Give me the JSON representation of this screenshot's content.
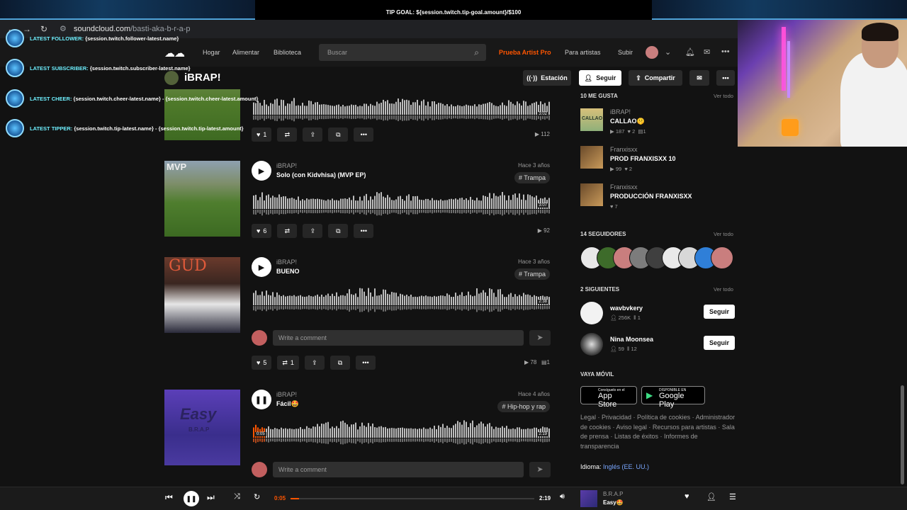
{
  "overlay": {
    "tip_goal": "TIP GOAL: ${session.twitch.tip-goal.amount}/$100",
    "alerts": [
      {
        "label": "LATEST FOLLOWER:",
        "value": "{session.twitch.follower-latest.name}"
      },
      {
        "label": "LATEST SUBSCRIBER:",
        "value": "{session.twitch.subscriber-latest.name}"
      },
      {
        "label": "LATEST CHEER:",
        "value": "{session.twitch.cheer-latest.name} - {session.twitch.cheer-latest.amount}"
      },
      {
        "label": "LATEST TIPPER:",
        "value": "{session.twitch.tip-latest.name} - {session.twitch.tip-latest.amount}"
      }
    ]
  },
  "browser": {
    "url_domain": "soundcloud.com",
    "url_path": "/basti-aka-b-r-a-p"
  },
  "header": {
    "logo": "SoundCloud",
    "nav": [
      "Hogar",
      "Alimentar",
      "Biblioteca"
    ],
    "search_placeholder": "Buscar",
    "artist_pro": "Prueba Artist Pro",
    "for_artists": "Para artistas",
    "upload": "Subir"
  },
  "profile": {
    "name": "iBRAP!",
    "station": "Estación",
    "follow": "Seguir",
    "share": "Compartir"
  },
  "tracks": [
    {
      "likes": "1",
      "plays": "112",
      "duration": "3:02"
    },
    {
      "artist": "iBRAP!",
      "title": "Solo (con Kidvhisa) (MVP EP)",
      "date": "Hace 3 años",
      "tag": "# Trampa",
      "duration": "3:07",
      "likes": "6",
      "plays": "92"
    },
    {
      "artist": "iBRAP!",
      "title": "BUENO",
      "date": "Hace 3 años",
      "tag": "# Trampa",
      "duration": "2:38",
      "likes": "5",
      "reposts": "1",
      "plays": "78",
      "comments": "1",
      "comment_placeholder": "Write a comment"
    },
    {
      "artist": "iBRAP!",
      "title": "Fácil🤩",
      "date": "Hace 4 años",
      "tag": "# Hip-hop y rap",
      "duration": "2:19",
      "elapsed": "0:05",
      "comment_placeholder": "Write a comment"
    }
  ],
  "sidebar": {
    "likes_title": "10 ME GUSTA",
    "view_all": "Ver todo",
    "likes": [
      {
        "artist": "iBRAP!",
        "title": "CALLAO🤫",
        "plays": "187",
        "likes": "2",
        "comments": "1",
        "art_text": "CALLAO"
      },
      {
        "artist": "Franxisxx",
        "title": "PROD FRANXISXX 10",
        "plays": "99",
        "likes": "2"
      },
      {
        "artist": "Franxisxx",
        "title": "PRODUCCIÓN FRANXISXX",
        "likes": "7"
      }
    ],
    "followers_title": "14 SEGUIDORES",
    "followers": [
      "#e8e8e8",
      "#3d6b2a",
      "#c97e7e",
      "#7c7c7c",
      "#3f3f3f",
      "#e9e9e9",
      "#d8d8d8",
      "#2f7fd8",
      "#c97e7e"
    ],
    "following_title": "2 SIGUIENTES",
    "following": [
      {
        "name": "wavbvkery",
        "followers": "256K",
        "tracks": "1",
        "follow": "Seguir"
      },
      {
        "name": "Nina Moonsea",
        "followers": "59",
        "tracks": "12",
        "follow": "Seguir"
      }
    ],
    "mobile_title": "VAYA MÓVIL",
    "app_store_small": "Consíguelo en el",
    "app_store_big": "App Store",
    "play_small": "DISPONIBLE EN",
    "play_big": "Google Play",
    "footer": "Legal · Privacidad · Política de cookies · Administrador de cookies · Aviso legal · Recursos para artistas · Sala de prensa · Listas de éxitos · Informes de transparencia",
    "language_label": "Idioma:",
    "language_value": "Inglés (EE. UU.)"
  },
  "player": {
    "current": "0:05",
    "total": "2:19",
    "progress": 0.036,
    "artist": "B.R.A.P",
    "title": "Easy🤩"
  },
  "colors": {
    "accent": "#ff5500",
    "background": "#121212"
  }
}
